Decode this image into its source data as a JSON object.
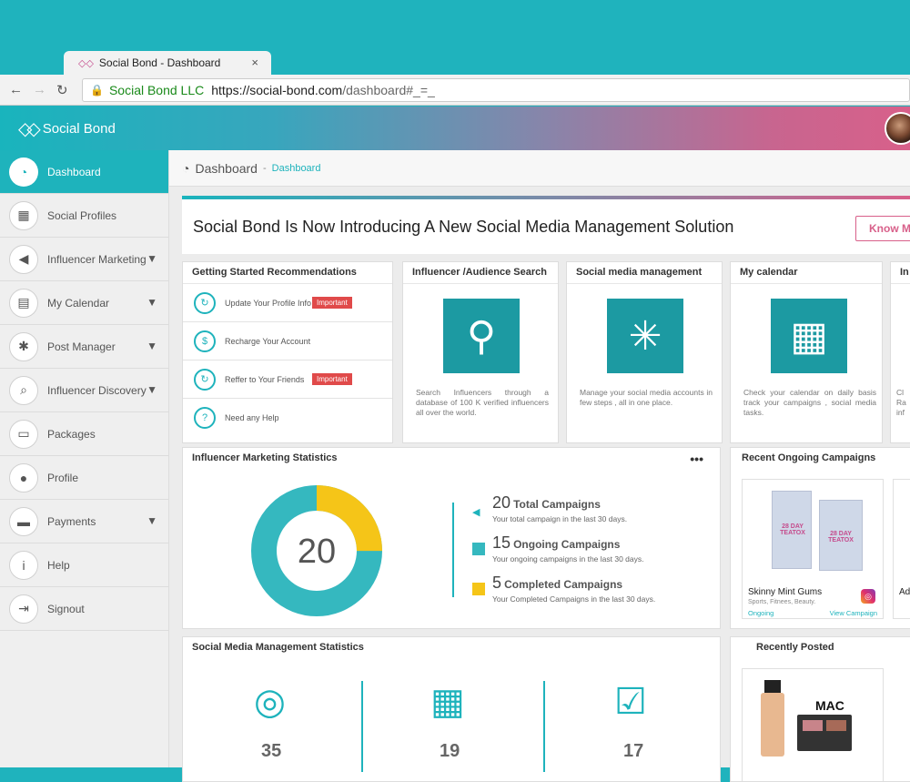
{
  "browser": {
    "tab_title": "Social Bond - Dashboard",
    "tab_close": "×",
    "url_org": "Social Bond LLC",
    "url_host": "https://social-bond.com",
    "url_path": "/dashboard#_=_"
  },
  "app": {
    "brand": "Social Bond"
  },
  "sidebar": {
    "items": [
      {
        "label": "Dashboard",
        "icon": "gauge-icon",
        "active": true
      },
      {
        "label": "Social Profiles",
        "icon": "profiles-icon"
      },
      {
        "label": "Influencer Marketing",
        "icon": "megaphone-icon",
        "expandable": true
      },
      {
        "label": "My Calendar",
        "icon": "calendar-icon",
        "expandable": true
      },
      {
        "label": "Post Manager",
        "icon": "network-icon",
        "expandable": true
      },
      {
        "label": "Influencer Discovery",
        "icon": "search-icon",
        "expandable": true
      },
      {
        "label": "Packages",
        "icon": "basket-icon"
      },
      {
        "label": "Profile",
        "icon": "user-icon"
      },
      {
        "label": "Payments",
        "icon": "card-icon",
        "expandable": true
      },
      {
        "label": "Help",
        "icon": "info-icon"
      },
      {
        "label": "Signout",
        "icon": "signout-icon"
      }
    ]
  },
  "breadcrumb": {
    "title": "Dashboard",
    "sep": "-",
    "current": "Dashboard"
  },
  "banner": {
    "headline": "Social Bond Is Now Introducing A New Social Media Management Solution",
    "button": "Know M"
  },
  "getting_started": {
    "title": "Getting Started Recommendations",
    "items": [
      {
        "label": "Update Your Profile Info",
        "badge": "Important"
      },
      {
        "label": "Recharge Your Account",
        "badge": ""
      },
      {
        "label": "Reffer to Your Friends",
        "badge": "Important"
      },
      {
        "label": "Need any Help",
        "badge": ""
      }
    ]
  },
  "feature_cards": [
    {
      "title": "Influencer /Audience Search",
      "desc": "Search Influencers through a database of 100 K verified influencers all over the world."
    },
    {
      "title": "Social media management",
      "desc": "Manage your social media accounts in few steps , all in one place."
    },
    {
      "title": "My calendar",
      "desc": "Check your calendar on daily basis track your campaigns , social media tasks."
    },
    {
      "title": "In",
      "desc": "Cl Ra inf"
    }
  ],
  "influencer_stats": {
    "title": "Influencer Marketing Statistics",
    "menu": "•••",
    "center_value": "20",
    "colors": {
      "ongoing": "#35b8bf",
      "completed": "#f5c518"
    },
    "rows": [
      {
        "num": "20",
        "label": "Total Campaigns",
        "sub": "Your total campaign in the last 30 days."
      },
      {
        "num": "15",
        "label": "Ongoing Campaigns",
        "sub": "Your ongoing campaigns in the last 30 days."
      },
      {
        "num": "5",
        "label": "Completed Campaigns",
        "sub": "Your Completed Campaigns in the last 30 days."
      }
    ],
    "ongoing": 15,
    "completed": 5
  },
  "recent_campaigns": {
    "title": "Recent Ongoing Campaigns",
    "items": [
      {
        "name": "Skinny Mint Gums",
        "tags": "Sports, Fitnees, Beauty.",
        "status": "Ongoing",
        "link": "View Campaign",
        "pack_text": "28 DAY TEATOX"
      },
      {
        "name": "Adi",
        "tags": "",
        "status": "",
        "link": "",
        "pack_text": ""
      }
    ]
  },
  "social_stats": {
    "title": "Social Media Management Statistics",
    "values": [
      "35",
      "19",
      "17"
    ]
  },
  "recently_posted": {
    "title": "Recently Posted",
    "brand_text": "MAC"
  }
}
